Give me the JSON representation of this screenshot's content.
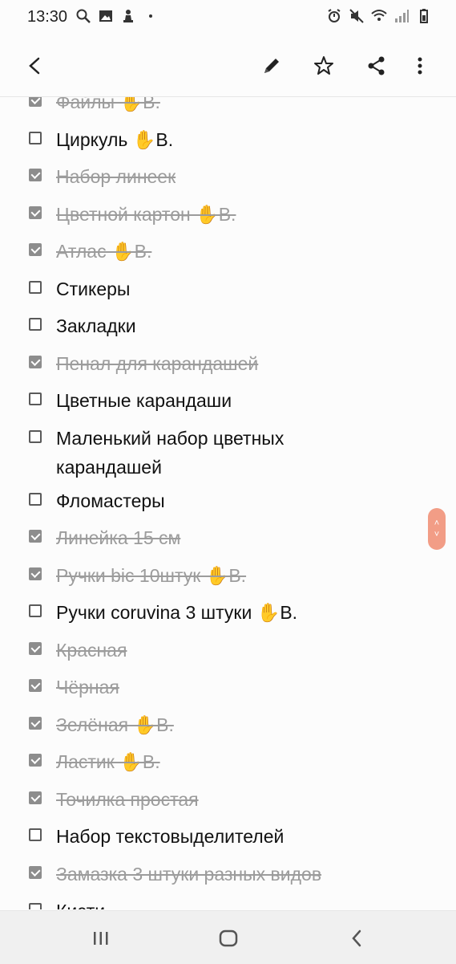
{
  "status": {
    "time": "13:30"
  },
  "items": [
    {
      "text": "Файлы ✋В.",
      "checked": true
    },
    {
      "text": "Циркуль ✋В.",
      "checked": false
    },
    {
      "text": "Набор линеек",
      "checked": true
    },
    {
      "text": "Цветной картон ✋В.",
      "checked": true
    },
    {
      "text": "Атлас ✋В.",
      "checked": true
    },
    {
      "text": "Стикеры",
      "checked": false
    },
    {
      "text": "Закладки",
      "checked": false
    },
    {
      "text": "Пенал для карандашей",
      "checked": true
    },
    {
      "text": "Цветные карандаши",
      "checked": false
    },
    {
      "text": "Маленький набор цветных карандашей",
      "checked": false
    },
    {
      "text": "Фломастеры",
      "checked": false
    },
    {
      "text": "Линейка 15 см",
      "checked": true
    },
    {
      "text": "Ручки bic 10штук ✋В.",
      "checked": true
    },
    {
      "text": "Ручки coruvina 3 штуки ✋В.",
      "checked": false
    },
    {
      "text": "Красная",
      "checked": true
    },
    {
      "text": "Чёрная",
      "checked": true
    },
    {
      "text": "Зелёная ✋В.",
      "checked": true
    },
    {
      "text": "Ластик ✋В.",
      "checked": true
    },
    {
      "text": "Точилка простая",
      "checked": true
    },
    {
      "text": "Набор текстовыделителей",
      "checked": false
    },
    {
      "text": "Замазка 3 штуки разных видов",
      "checked": true
    },
    {
      "text": "Кисти",
      "checked": false
    }
  ],
  "icons": {
    "back": "back-arrow-icon",
    "edit": "pencil-icon",
    "favorite": "star-icon",
    "share": "share-icon",
    "more": "more-vert-icon"
  },
  "colors": {
    "scroll_handle": "#f29d86",
    "checked_box": "#8d8d8d"
  }
}
